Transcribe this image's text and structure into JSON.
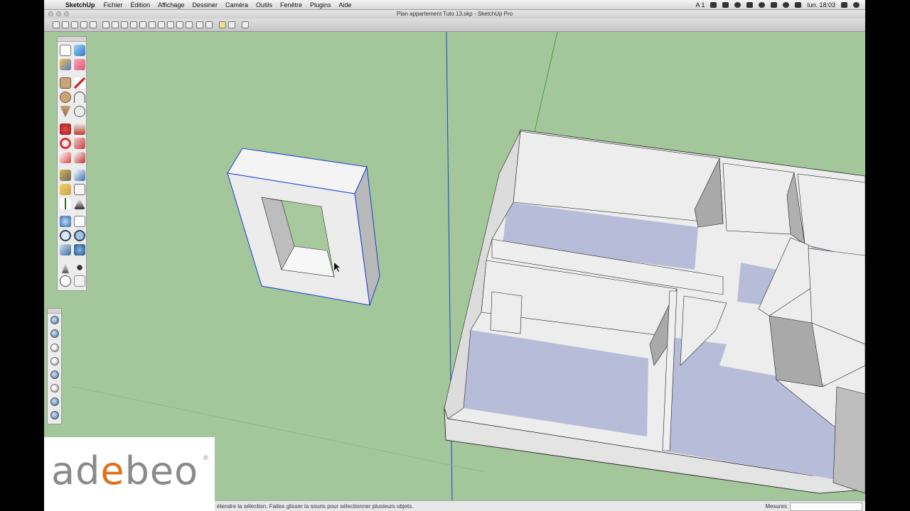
{
  "menubar": {
    "app_name": "SketchUp",
    "items": [
      "Fichier",
      "Édition",
      "Affichage",
      "Dessiner",
      "Caméra",
      "Outils",
      "Fenêtre",
      "Plugins",
      "Aide"
    ],
    "clock": "lun. 18:03",
    "input_indicator": "A 1"
  },
  "window": {
    "title": "Plan appartement Tuto 13.skp - SketchUp Pro"
  },
  "statusbar": {
    "hint": "r étendre la sélection. Faites glisser la souris pour sélectionner plusieurs objets.",
    "measurements_label": "Mesures",
    "measurements_value": ""
  },
  "logo": {
    "text_grey_1": "ad",
    "text_orange": "e",
    "text_grey_2": "beo",
    "registered": "®"
  },
  "colors": {
    "ground": "#a3c79a",
    "wall": "#eeeeee",
    "floor": "#b7bcd8",
    "selection": "#1a3fd6",
    "logo_accent": "#e0711c"
  },
  "icons": {
    "large_tool_palette": [
      "select-icon",
      "component-icon",
      "paint-bucket-icon",
      "eraser-icon",
      "rectangle-icon",
      "line-icon",
      "circle-icon",
      "arc-icon",
      "polygon-icon",
      "freehand-icon",
      "move-icon",
      "push-pull-icon",
      "rotate-icon",
      "follow-me-icon",
      "scale-icon",
      "offset-icon",
      "tape-measure-icon",
      "dimension-icon",
      "protractor-icon",
      "text-icon",
      "axes-icon",
      "3d-text-icon",
      "orbit-icon",
      "pan-icon",
      "zoom-icon",
      "zoom-window-icon",
      "zoom-extents-icon",
      "previous-view-icon",
      "position-camera-icon",
      "walk-icon",
      "look-around-icon",
      "section-plane-icon"
    ],
    "views_palette": [
      "iso-view-icon",
      "top-view-icon",
      "front-view-icon",
      "right-view-icon",
      "back-view-icon",
      "left-view-icon",
      "bottom-view-icon",
      "perspective-icon"
    ]
  }
}
